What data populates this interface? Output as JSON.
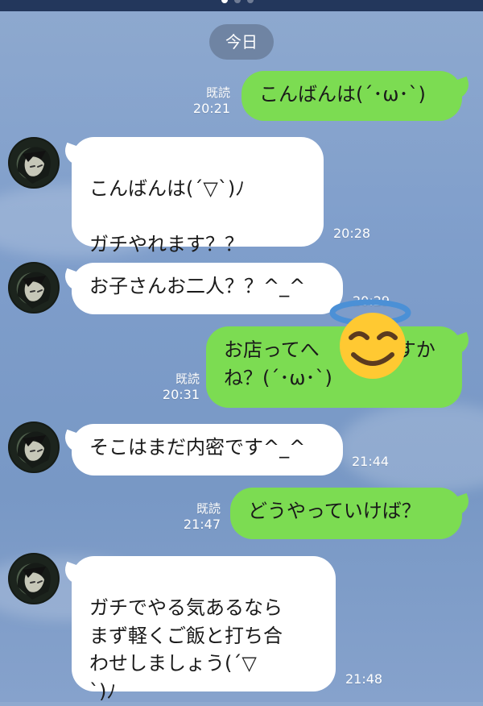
{
  "header": {
    "page_dots": [
      false,
      false,
      true
    ]
  },
  "date_label": "今日",
  "read_label": "既読",
  "messages": [
    {
      "side": "out",
      "text": "こんばんは(´･ω･`)",
      "time": "20:21",
      "read": true
    },
    {
      "side": "in",
      "text": "こんばんは(´▽`)ﾉ\n\nガチやれます？？",
      "time": "20:28"
    },
    {
      "side": "in",
      "text": "お子さんお二人？？^_^",
      "time": "20:29"
    },
    {
      "side": "out",
      "text": "お店ってへ　　　ですかね？(´･ω･`)",
      "time": "20:31",
      "read": true
    },
    {
      "side": "in",
      "text": "そこはまだ内密です^_^",
      "time": "21:44"
    },
    {
      "side": "out",
      "text": "どうやっていけば？",
      "time": "21:47",
      "read": true
    },
    {
      "side": "in",
      "text": "ガチでやる気あるなら\nまず軽くご飯と打ち合\nわせしましょう(´▽\n`)ﾉ",
      "time": "21:48"
    }
  ],
  "sticker": {
    "icon": "smiling-halo-emoji"
  }
}
